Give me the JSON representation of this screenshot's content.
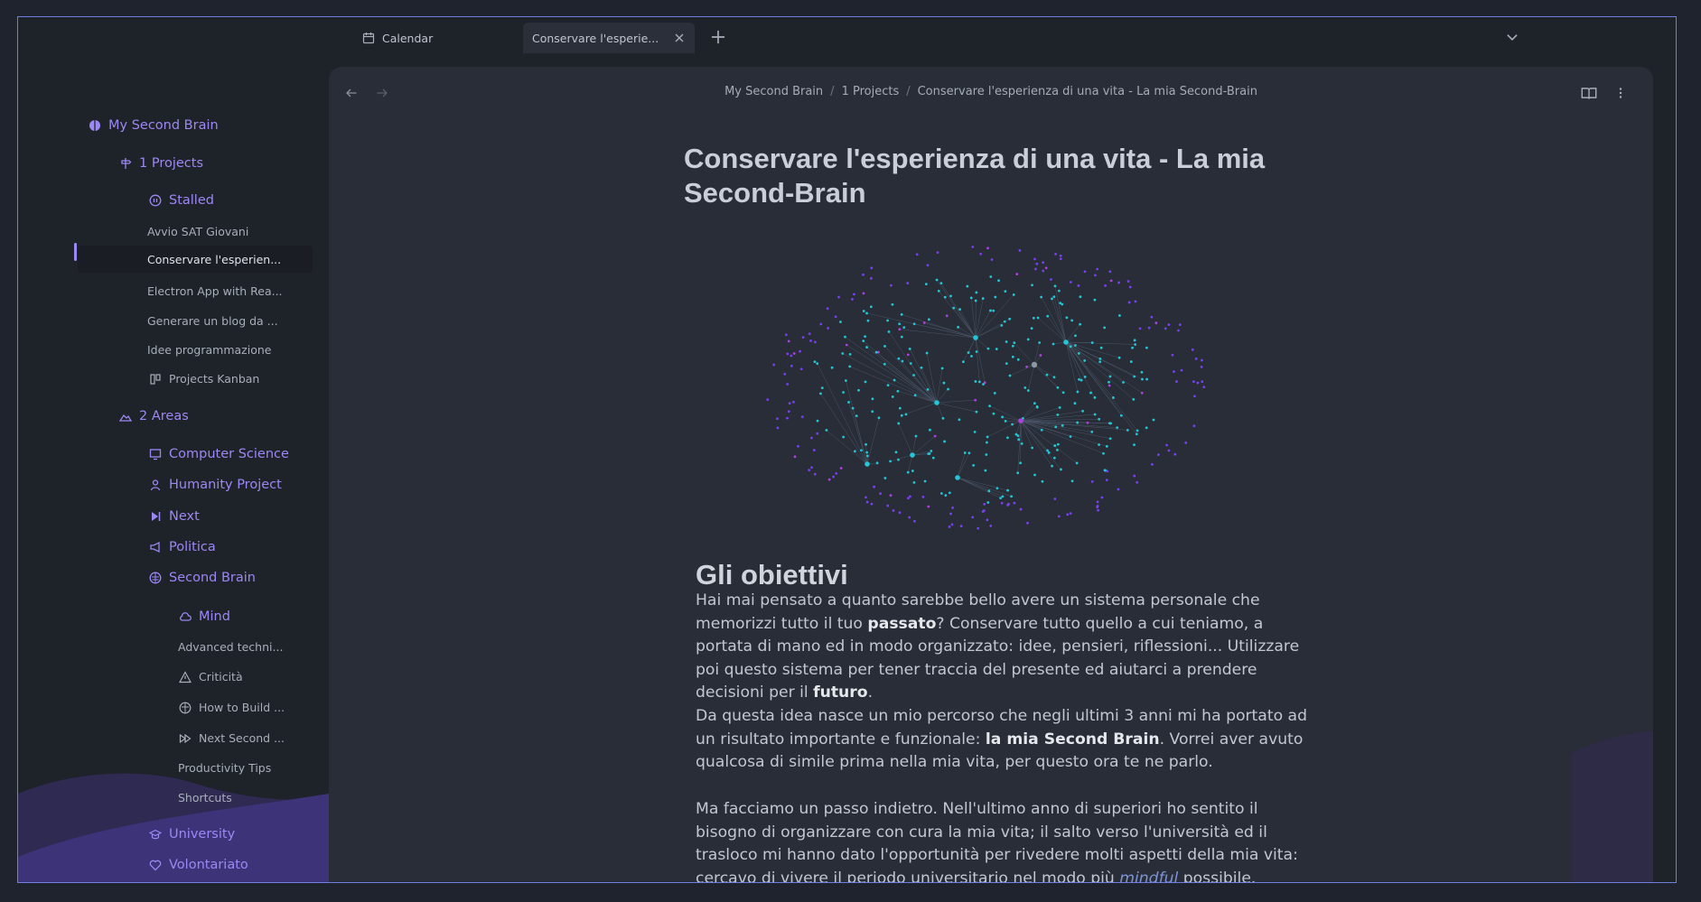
{
  "tabs": [
    {
      "label": "Calendar",
      "icon": "calendar-icon"
    },
    {
      "label": "Conservare l'esperie...",
      "icon": "close-icon"
    }
  ],
  "breadcrumb": [
    "My Second Brain",
    "1 Projects",
    "Conservare l'esperienza di una vita - La mia Second-Brain"
  ],
  "sidebar": {
    "root": "My Second Brain",
    "projects": "1 Projects",
    "stalled": "Stalled",
    "project_items": [
      "Avvio SAT Giovani",
      "Conservare l'esperien...",
      "Electron App with Rea...",
      "Generare un blog da ...",
      "Idee programmazione",
      "Projects Kanban"
    ],
    "areas": "2 Areas",
    "area_items": [
      "Computer Science",
      "Humanity Project",
      "Next",
      "Politica",
      "Second Brain"
    ],
    "mind": "Mind",
    "mind_items": [
      "Advanced techni...",
      "Criticità",
      "How to Build ...",
      "Next Second ...",
      "Productivity Tips",
      "Shortcuts"
    ],
    "bottom_items": [
      "University",
      "Volontariato"
    ]
  },
  "document": {
    "title": "Conservare l'esperienza di una vita - La mia Second-Brain",
    "heading": "Gli obiettivi",
    "p1": {
      "a": "Hai mai pensato a quanto sarebbe bello avere un sistema personale che memorizzi tutto il tuo ",
      "b1": "passato",
      "c": "? Conservare tutto quello a cui teniamo, a portata di mano ed in modo organizzato: idee, pensieri, riflessioni... Utilizzare poi questo sistema per tener traccia del presente ed aiutarci a prendere decisioni per il ",
      "b2": "futuro",
      "d": "."
    },
    "p2": {
      "a": "Da questa idea nasce un mio percorso che negli ultimi 3 anni mi ha portato ad un risultato importante e funzionale: ",
      "b": "la mia Second Brain",
      "c": ". Vorrei aver avuto qualcosa di simile prima nella mia vita, per questo ora te ne parlo."
    },
    "p3": {
      "a": "Ma facciamo un passo indietro. Nell'ultimo anno di superiori ho sentito il bisogno di organizzare con cura la mia vita; il salto verso l'università ed il trasloco mi hanno dato l'opportunità per rivedere molti aspetti della mia vita: cercavo di vivere il periodo universitario nel modo più ",
      "i": "mindful",
      "c": " possibile."
    }
  },
  "colors": {
    "accent": "#9c88f5",
    "frame": "#6f7fe0",
    "graph_cyan": "#22c6d6",
    "graph_purple": "#7a3ff0",
    "graph_magenta": "#b040e0"
  }
}
